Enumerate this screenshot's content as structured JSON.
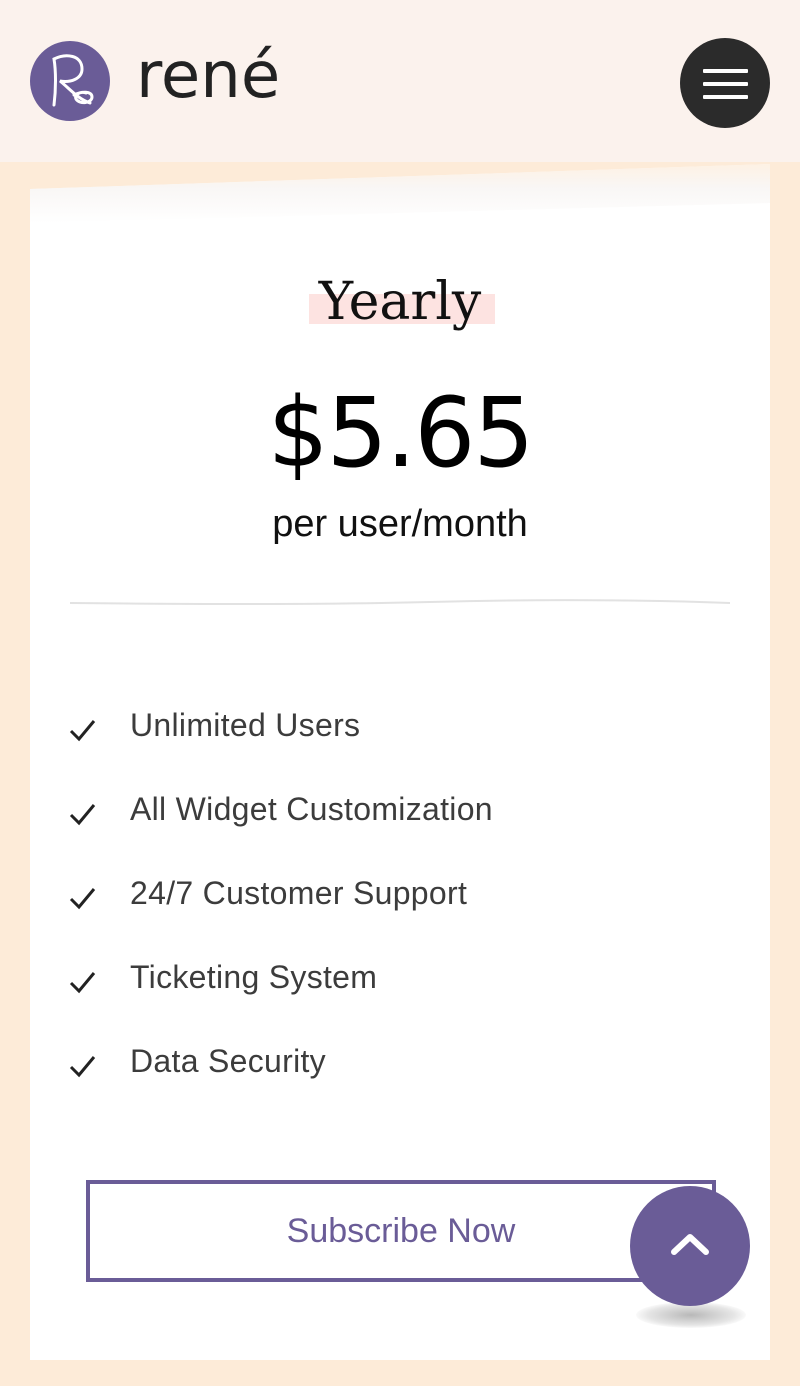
{
  "header": {
    "brand_name": "rené",
    "logo_initials": "Re",
    "logo_icon": "rene-logo-icon",
    "menu_icon": "hamburger-menu-icon"
  },
  "plan": {
    "title": "Yearly",
    "price": "$5.65",
    "per_unit": "per user/month",
    "features": [
      "Unlimited Users",
      "All Widget Customization",
      "24/7 Customer Support",
      "Ticketing System",
      "Data Security"
    ],
    "feature_icon": "check-icon",
    "cta_label": "Subscribe Now"
  },
  "back_to_top_icon": "chevron-up-icon",
  "colors": {
    "accent": "#6a5c97",
    "page_background": "#fdebd8",
    "header_background": "#fbf2ed",
    "title_highlight": "#fde3e1",
    "menu_button": "#2b2b2b"
  }
}
